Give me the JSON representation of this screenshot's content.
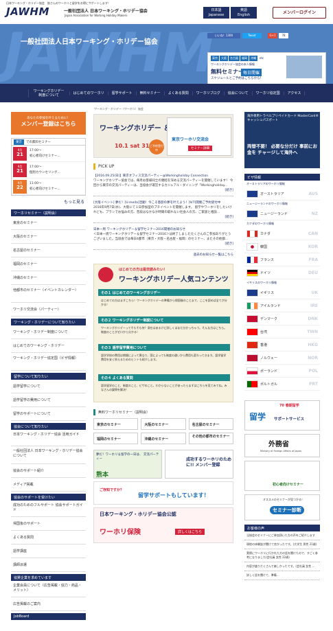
{
  "header": {
    "tagline": "日本ワーキング・ホリデー協会　皆さんのワーホリと留学をお得にサポートします！",
    "logo": "JAWHM",
    "org_jp": "一般社団法人 日本ワーキング・ホリデー協会",
    "org_en": "Japan Association for Working Holiday Makers",
    "lang_jp_1": "日本語",
    "lang_jp_2": "Japanese",
    "lang_en_1": "英語",
    "lang_en_2": "English",
    "login": "メンバーログイン"
  },
  "banner": {
    "bg_text": "JAWHM",
    "title": "一般社団法人日本ワーキング・ホリデー協会",
    "like": "いいね！1300",
    "tweet": "Tweet",
    "gplus": "G+1",
    "gcount": "78",
    "cities": [
      "東京",
      "大阪",
      "名古屋",
      "福岡",
      "沖縄",
      "etc"
    ],
    "sub": "ワーキングホリデー協会の本人情報",
    "title2": "無料セミナー",
    "time": "毎日開催",
    "note": "スケジュールとご予約はこちらから！"
  },
  "nav": [
    "ワーキングホリデー 制度について",
    "はじめてのワーホリ",
    "留学サポート",
    "無料セミナー",
    "よくある質問",
    "ワーホリブログ",
    "協会について",
    "ワーホリ協定国",
    "アクセス"
  ],
  "breadcrumb": "ワーキング・ホリデー（ワーホリ）協会",
  "left": {
    "member_small": "あなたの参加を叶えるために！",
    "member_big": "メンバー登録はこちら",
    "sched_tag": "東京",
    "sched_title": "での無料セミナー",
    "sched": [
      {
        "month": "9月",
        "day": "21",
        "time": "17:00〜",
        "title": "初心者向けセミナー..."
      },
      {
        "month": "9月",
        "day": "21",
        "time": "17:00〜",
        "title": "個別カウンセリング..."
      },
      {
        "month": "9月",
        "day": "22",
        "time": "11:00〜",
        "title": "初心者向けセミナー..."
      }
    ],
    "more": "もっと見る",
    "sections": [
      {
        "title": "ワーホリセミナー（説明会）",
        "items": [
          "東京のセミナー",
          "大阪のセミナー",
          "名古屋のセミナー",
          "福岡のセミナー",
          "沖縄のセミナー",
          "他都市のセミナー（イベントカレンダー）",
          "ワーホリ交流会（パーティー）"
        ]
      },
      {
        "title": "ワーキング・ホリデーについて知りたい",
        "items": [
          "ワーキング・ホリデー制度について",
          "はじめてのワーキング・ホリデー",
          "ワーキング・ホリデー協定国（ビザ情報）"
        ]
      },
      {
        "title": "留学について知りたい",
        "items": [
          "語学留学について",
          "語学留学の費用について",
          "留学のサポートについて"
        ]
      },
      {
        "title": "協会について知りたい",
        "items": [
          "日本ワーキング・ホリデー協会 活用ガイド",
          "一般社団法人 日本ワーキング・ホリデー協会について",
          "協会のサポート紹介",
          "メディア掲載"
        ]
      },
      {
        "title": "協会のサポートを受けたい",
        "items": [
          "成功のためのフルサポート 協会サポートガイド",
          "帰国後のサポート",
          "よくある質問",
          "語学講座",
          "講師派遣"
        ]
      },
      {
        "title": "協賛企業を求めています",
        "items": [
          "企業会員について（広告掲載・協力・商品・メリット）",
          "広告掲載のご案内"
        ]
      },
      {
        "title": "JobBoard",
        "items": []
      }
    ]
  },
  "middle": {
    "fair_title": "ワーキングホリデー ＆留学フェア",
    "fair_date": "10.1 sat 31",
    "fair_badge": "ご予約受付中",
    "fair_sub": "東京ワーホリ交流会",
    "fair_sub2": "セミナー詳細",
    "pickup": "PICK UP",
    "news": [
      {
        "title": "【2016.09.25(日)】東京オフィス交流パーティー@Workingholiday Connection",
        "body": "ワーキングホリデー協会では、毎月お客様同士の親睦を深める交流パーティーを開催しています！ 今回から東京の交流パーティーは、当協会が運営するカジュアル・ダイニング「Workingholiday...",
        "link": "[続き]"
      },
      {
        "title": "[大阪イベント] 夢だ！[U-meda]活動！今こそ意欲の夢を叶えよう！[9/7]開催ご予約受付中",
        "body": "2016年9月7日(水)、大阪にて１日参加型のプチイベントを開催します。 留学やワーホリをしたいけれども、プランでお悩みの方、普段はなかなか時間の取れない社会人の方、ご家族と相談...",
        "link": "[続き]"
      },
      {
        "title": "日本一周 ワーキングホリデー＆留学セミナー2016開催のお知らせ",
        "body": "＜日本一周ワーキングホリデー＆留学セミナー2016＞は終了しましたたくさんのご参加ありがとうございました。当協会では毎日4都市（東京・大阪・名古屋・福岡）のセミナー、またその他都...",
        "link": "[続き]"
      }
    ],
    "news_more": "過去のお知らせ一覧はこちら",
    "pop_sub": "はじめての方は是非読みたい！",
    "pop_title": "ワーキングホリデー人気コンテンツ",
    "pop_sections": [
      {
        "title": "その１ はじめてのワーキングホリデー",
        "text": "はじめての方はまずこちら！ワーキングホリデーの準備から帰国後のことまで、ここを読めば全てが分かる！"
      },
      {
        "title": "その２ ワーキングホリデー制度について",
        "text": "ワーキングホリデーってそもそも何？滞在はあるけど詳しくはまだ分かっちゃう。そんな方はこちら。制度のことがゼロから分かる！"
      },
      {
        "title": "その３ 語学留学費用について",
        "text": "語学学校の費用は期間によって異なり、国によっても制度の違いから費用も変わってきます。語学留学費用を安く抑えるためのヒントも紹介します。"
      },
      {
        "title": "その４ よくある質問",
        "text": "語学留学のこと、制度のこと、ビザのこと。わからないことがあったらまずはこちらを見てみてね。みなさんの疑問を解決！"
      }
    ],
    "sem_list_title": "無料ワーホリセミナー（説明会）",
    "sem_cells": [
      "東京のセミナー",
      "大阪のセミナー",
      "名古屋のセミナー",
      "福岡のセミナー",
      "沖縄のセミナー",
      "その他の都市のセミナー"
    ],
    "ban1": "夢だ！ワーホリ＆留学の一日は、 交流パーティー",
    "ban1b": "熊本",
    "ban2": "成功するワーホリのために!! メンバー登録",
    "ban3": "ご存知ですか？",
    "ban3b": "留学サポートもしています！",
    "ban4": "日本ワーキング・ホリデー協会公認",
    "ban4b": "ワーホリ保険",
    "ban4c": "詳しくはこちら"
  },
  "right": {
    "card_t": "海外専用トラベルプリペイドカード MasterCard® キャッシュパスポート",
    "card_b": "両替不要！ 必要な分だけ 事前にお金を チャージして海外へ",
    "visa_h": "ビザ情報",
    "visa_sub1": "オーストラリアのワーホリ情報",
    "visa_sub2": "ニュージーランドのワーホリ情報",
    "visa_sub3": "カナダのワーホリ情報",
    "visa_sub4": "イギリスのワーホリ情報",
    "visas": [
      {
        "name": "オーストラリア",
        "code": "AUS"
      },
      {
        "name": "ニュージーランド",
        "code": "NZ"
      },
      {
        "name": "カナダ",
        "code": "CAN"
      },
      {
        "name": "韓国",
        "code": "KOR"
      },
      {
        "name": "フランス",
        "code": "FRA"
      },
      {
        "name": "ドイツ",
        "code": "DEU"
      },
      {
        "name": "イギリス",
        "code": "UK"
      },
      {
        "name": "アイルランド",
        "code": "IRE"
      },
      {
        "name": "デンマーク",
        "code": "DNK"
      },
      {
        "name": "台湾",
        "code": "TWN"
      },
      {
        "name": "香港",
        "code": "HKG"
      },
      {
        "name": "ノルウェー",
        "code": "NOR"
      },
      {
        "name": "ポーランド",
        "code": "POL"
      },
      {
        "name": "ポルトガル",
        "code": "PRT"
      }
    ],
    "ad1": "70 春期留学",
    "ad1b": "留学",
    "ad1c": "サポートサービス",
    "ad2": "外務省",
    "ad2b": "Ministry of Foreign Affairs of Japan",
    "ad3": "初心者向けセミナー",
    "ad4": "セミナー診断",
    "ad4b": "オススメのセミナーが見つかる！",
    "voice_h": "お客様の声",
    "voices": [
      "当協会のセミナーにご参加頂いた方の声をご紹介します",
      "現地の体験談が聞けて良かったです。(大学生 男性 21歳)",
      "実際にワーホリに行かれた方の話を聞けたので、すごく参考になりました(会社員 女性 22歳)",
      "内容が盛りだくさんで楽しかったです。(会社員 女性 ...",
      "詳しく話を聞けて、準備..."
    ]
  }
}
